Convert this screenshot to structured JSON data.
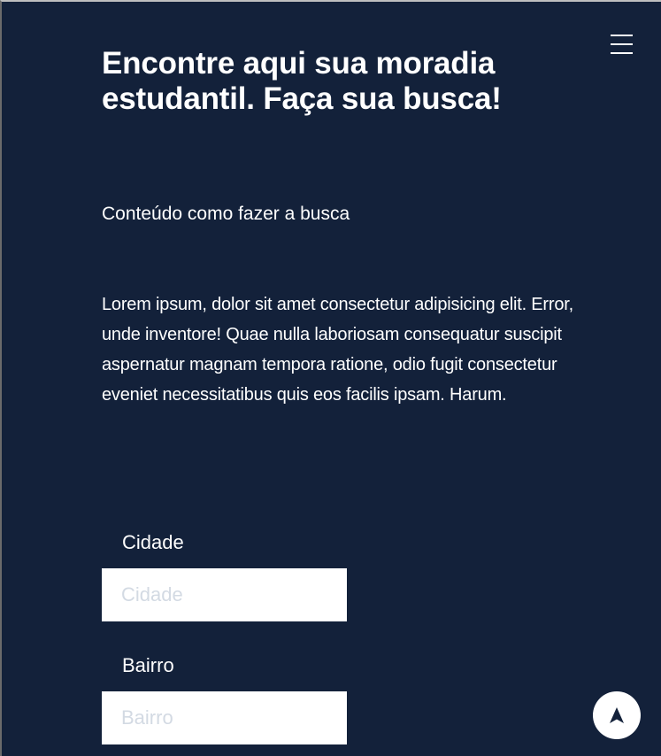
{
  "header": {
    "menu_icon": "hamburger-menu-icon"
  },
  "hero": {
    "title_line1": "Encontre aqui sua moradia",
    "title_line2": "estudantil. Faça sua busca!",
    "subtitle": "Conteúdo como fazer a busca",
    "body": "Lorem ipsum, dolor sit amet consectetur adipisicing elit. Error, unde inventore! Quae nulla laboriosam consequatur suscipit aspernatur magnam tempora ratione, odio fugit consectetur eveniet necessitatibus quis eos facilis ipsam. Harum."
  },
  "form": {
    "city": {
      "label": "Cidade",
      "placeholder": "Cidade",
      "value": ""
    },
    "neighborhood": {
      "label": "Bairro",
      "placeholder": "Bairro",
      "value": ""
    }
  },
  "fab": {
    "icon": "navigation-arrow-icon"
  },
  "colors": {
    "background": "#13213a",
    "text": "#ffffff",
    "input_background": "#ffffff",
    "placeholder": "#d3dae3",
    "fab_background": "#ffffff",
    "fab_icon": "#13213a"
  }
}
